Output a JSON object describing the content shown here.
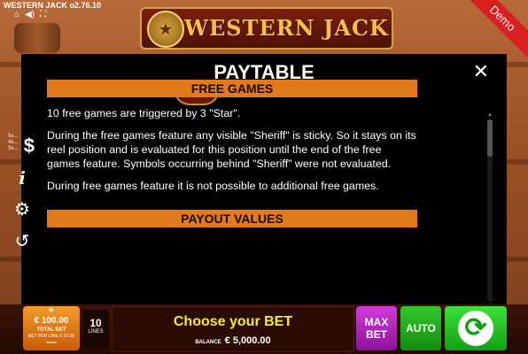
{
  "game": {
    "title": "WESTERN JACK o2.76.10",
    "logo_text": "WESTERN JACK",
    "demo_ribbon": "Demo"
  },
  "topbar_icons": [
    "home-icon",
    "sound-icon",
    "fullscreen-icon"
  ],
  "paytable": {
    "title": "PAYTABLE",
    "close_icon": "close-icon",
    "free_games": {
      "heading": "FREE GAMES",
      "paragraphs": [
        "10 free games are triggered by 3 \"Star\".",
        "During the free games feature any visible \"Sheriff\" is sticky. So it stays on its reel position and is evaluated for this position until the end of the free games feature. Symbols occurring behind \"Sheriff\" were not evaluated.",
        "During free games feature it is not possible to additional free games."
      ]
    },
    "payout_values": {
      "heading": "PAYOUT VALUES"
    }
  },
  "side_menu": {
    "paytable_multipliers": [
      "5x...",
      "4x...",
      "3x..."
    ],
    "paytable_icon": "$",
    "info_icon": "i",
    "settings_icon": "gear-icon",
    "history_icon": "history-icon"
  },
  "bottom_bar": {
    "bet_plus": "+",
    "bet_amount": "€ 100.00",
    "total_bet_label": "TOTAL BET",
    "bet_per_line": "BET PER LINE € 10.00",
    "bet_minus": "—",
    "lines_value": "10",
    "lines_label": "LINES",
    "choose_message": "Choose your BET",
    "balance_label": "BALANCE",
    "balance_value": "€ 5,000.00",
    "max_bet_line1": "MAX",
    "max_bet_line2": "BET",
    "auto_label": "AUTO",
    "spin_icon": "spin-icon"
  },
  "colors": {
    "section_header": "#e07a1d",
    "choose_text": "#f7e83a",
    "max_bet": "#c126c9",
    "auto": "#22b01f",
    "spin": "#22c01f",
    "bet": "#e57e16",
    "demo": "#d82020"
  }
}
